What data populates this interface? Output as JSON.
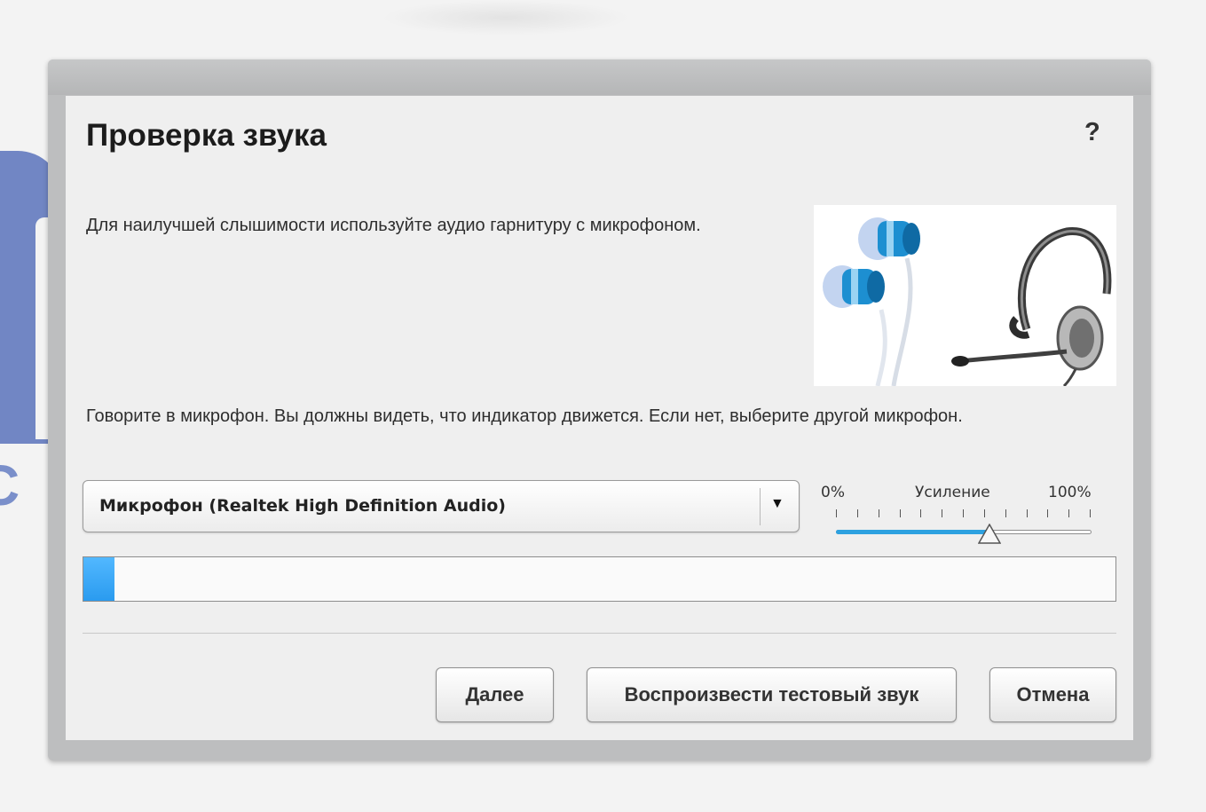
{
  "dialog": {
    "title": "Проверка звука",
    "help_label": "?",
    "intro_text": "Для наилучшей слышимости используйте аудио гарнитуру с микрофоном.",
    "image_icon": "headset-earphones-icon",
    "speak_text": "Говорите в микрофон. Вы должны видеть, что индикатор движется. Если нет, выберите другой микрофон."
  },
  "microphone": {
    "selected": "Микрофон (Realtek High Definition Audio)",
    "arrow_icon": "chevron-down-icon"
  },
  "gain": {
    "label": "Усиление",
    "min_label": "0%",
    "max_label": "100%",
    "level_fraction": 0.6
  },
  "input_meter": {
    "level_fraction": 0.03
  },
  "buttons": {
    "next": "Далее",
    "play_test": "Воспроизвести тестовый звук",
    "cancel": "Отмена"
  },
  "colors": {
    "accent": "#2da1e0",
    "meter": "#3aa9f7"
  }
}
